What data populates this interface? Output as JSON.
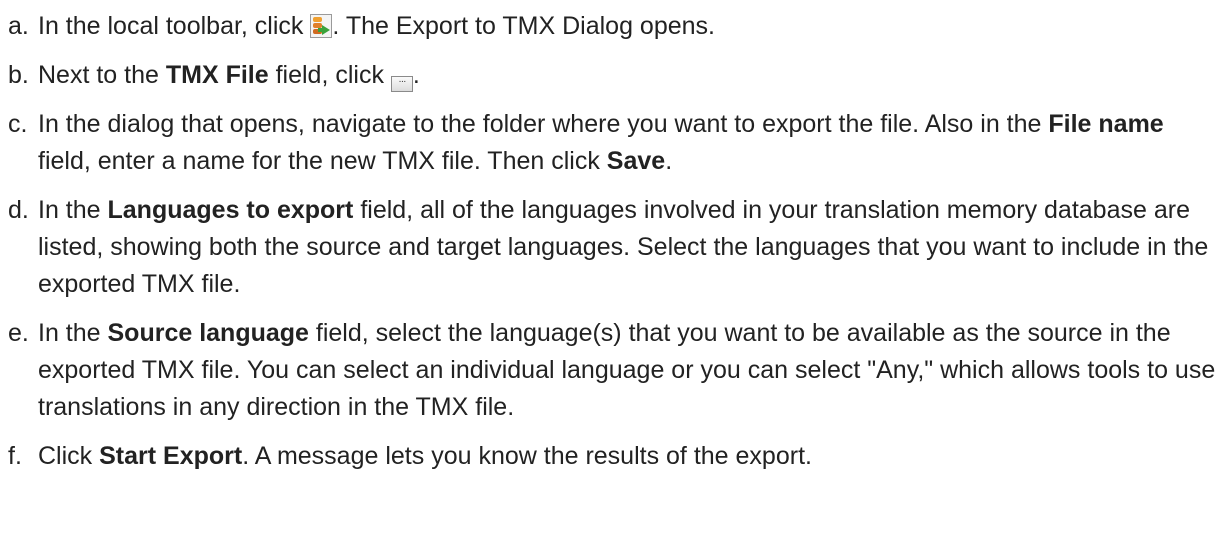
{
  "steps": [
    {
      "marker": "a.",
      "t1": "In the local toolbar, click ",
      "t2": ". The Export to TMX Dialog opens."
    },
    {
      "marker": "b.",
      "t1": "Next to the ",
      "b1": "TMX File",
      "t2": " field, click ",
      "t3": "."
    },
    {
      "marker": "c.",
      "t1": "In the dialog that opens, navigate to the folder where you want to export the file. Also in the ",
      "b1": "File name",
      "t2": " field, enter a name for the new TMX file. Then click ",
      "b2": "Save",
      "t3": "."
    },
    {
      "marker": "d.",
      "t1": "In the ",
      "b1": "Languages to export",
      "t2": " field, all of the languages involved in your translation memory database are listed, showing both the source and target languages. Select the languages that you want to include in the exported TMX file."
    },
    {
      "marker": "e.",
      "t1": "In the ",
      "b1": "Source language",
      "t2": " field, select the language(s) that you want to be available as the source in the exported TMX file. You can select an individual language or you can select \"Any,\" which allows tools to use translations in any direction in the TMX file."
    },
    {
      "marker": "f.",
      "t1": "Click ",
      "b1": "Start Export",
      "t2": ". A message lets you know the results of the export."
    }
  ],
  "icons": {
    "export": "export-tmx-icon",
    "browse": "browse-ellipsis-icon",
    "browse_glyph": "···"
  }
}
